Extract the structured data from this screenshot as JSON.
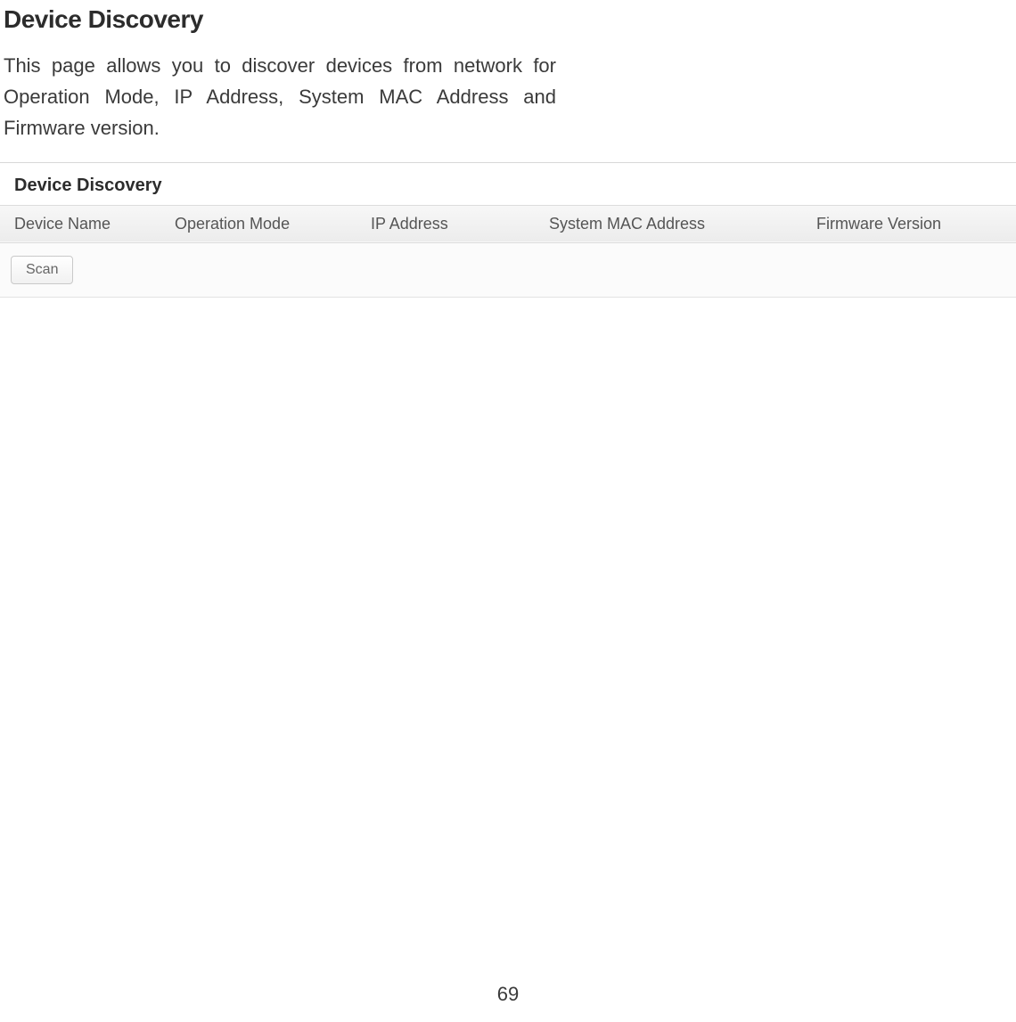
{
  "page": {
    "title": "Device Discovery",
    "intro": "This page allows you to discover devices from network for Operation Mode, IP Address, System MAC Address and Firmware version.",
    "number": "69"
  },
  "panel": {
    "title": "Device Discovery",
    "columns": {
      "device_name": "Device Name",
      "operation_mode": "Operation Mode",
      "ip_address": "IP Address",
      "system_mac": "System MAC Address",
      "firmware": "Firmware Version"
    },
    "scan_label": "Scan"
  }
}
